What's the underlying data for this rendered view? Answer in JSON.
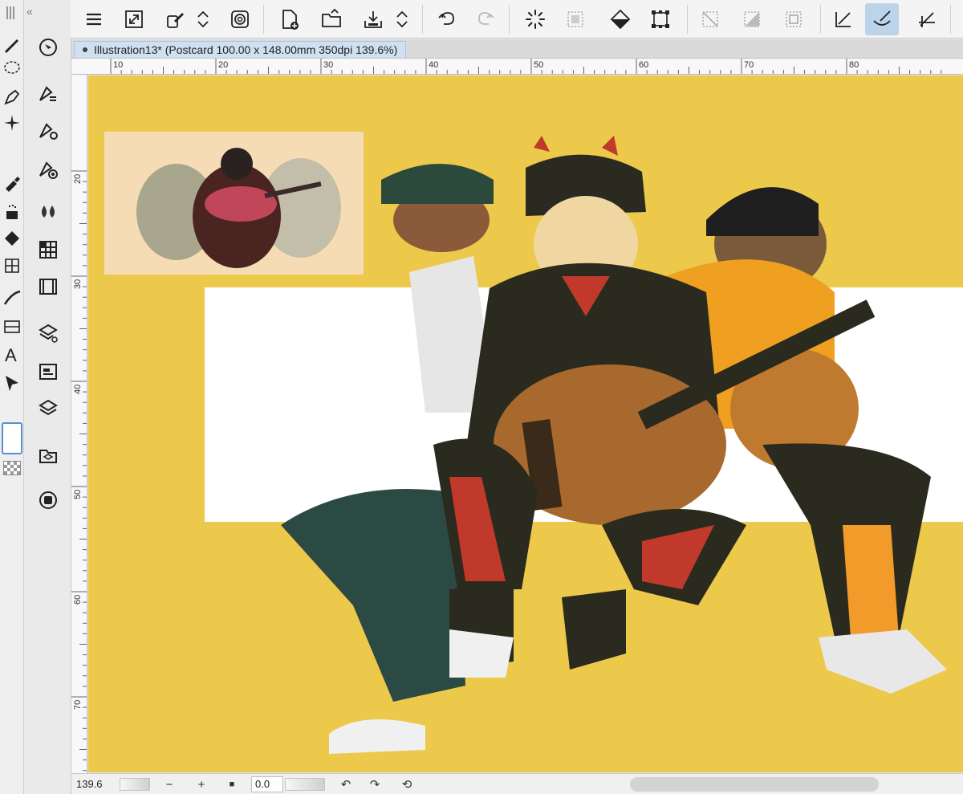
{
  "toolbar": {
    "buttons": [
      {
        "name": "menu-icon"
      },
      {
        "name": "fit-canvas-icon"
      },
      {
        "name": "transform-icon"
      },
      {
        "name": "expand-arrows-icon"
      },
      {
        "name": "spiral-icon"
      },
      {
        "name": "new-file-icon"
      },
      {
        "name": "open-folder-icon"
      },
      {
        "name": "save-icon"
      },
      {
        "name": "save-options-icon"
      },
      {
        "name": "undo-icon"
      },
      {
        "name": "redo-icon"
      },
      {
        "name": "loading-spinner-icon"
      },
      {
        "name": "selection-dotted-icon"
      },
      {
        "name": "fill-bucket-icon"
      },
      {
        "name": "transform-box-icon"
      },
      {
        "name": "deselect-icon"
      },
      {
        "name": "mask-icon"
      },
      {
        "name": "frame-icon"
      },
      {
        "name": "ruler-draw-icon"
      },
      {
        "name": "brush-icon"
      },
      {
        "name": "perspective-icon"
      }
    ]
  },
  "document": {
    "tab_title": "Illustration13* (Postcard 100.00 x 148.00mm 350dpi 139.6%)"
  },
  "ruler": {
    "top_ticks": [
      "10",
      "20",
      "30",
      "40",
      "50",
      "60",
      "70",
      "80"
    ],
    "left_ticks": [
      "20",
      "30",
      "40",
      "50",
      "60",
      "70"
    ]
  },
  "status": {
    "zoom_value": "139.6",
    "zoom_out": "−",
    "zoom_in": "+",
    "angle_value": "0.0",
    "rotate_left": "↶",
    "rotate_right": "↷",
    "reset": "⟲"
  },
  "colors": {
    "canvas_background": "#ecc94a",
    "white_band": "#ffffff",
    "reference_panel": "#f5dcb4",
    "active_tool": "#bcd4ea"
  }
}
